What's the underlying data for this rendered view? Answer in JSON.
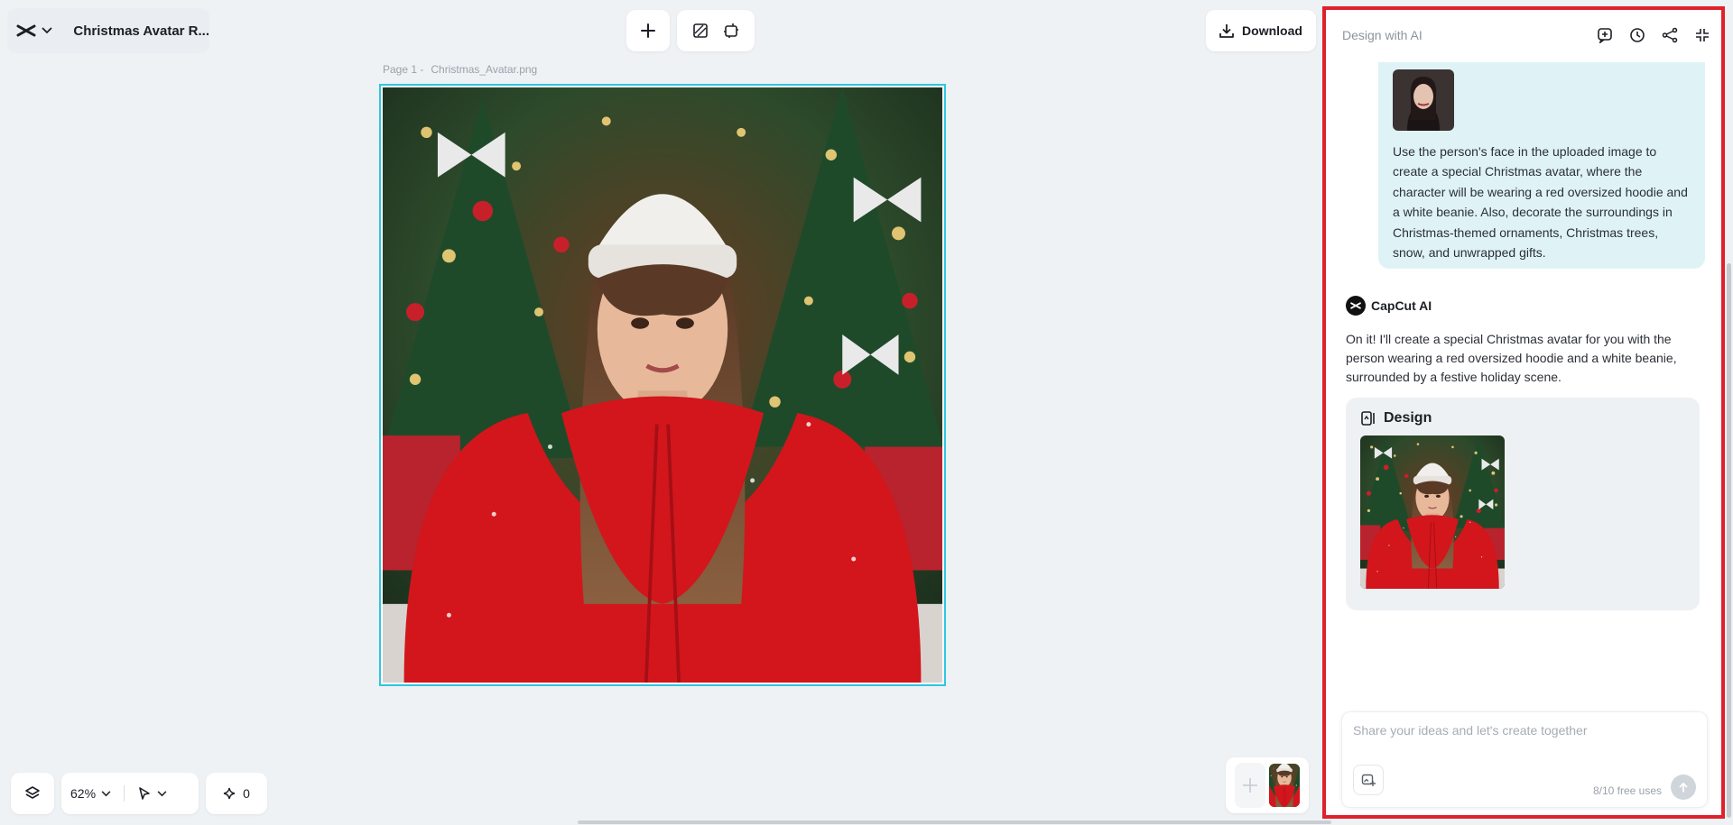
{
  "app": {
    "document_title": "Christmas Avatar R..."
  },
  "toolbar": {
    "download_label": "Download"
  },
  "canvas": {
    "page_label": "Page 1 -",
    "file_name": "Christmas_Avatar.png"
  },
  "bottom_bar": {
    "zoom": "62%",
    "credits": "0"
  },
  "panel": {
    "title": "Design with AI",
    "user_message": "Use the person's face in the uploaded image to create a special Christmas avatar, where the character will be wearing a red oversized hoodie and a white beanie. Also, decorate the surroundings in Christmas-themed ornaments, Christmas trees, snow, and unwrapped gifts.",
    "assistant_name": "CapCut AI",
    "assistant_message": "On it! I'll create a special Christmas avatar for you with the person wearing a red oversized hoodie and a white beanie, surrounded by a festive holiday scene.",
    "design_card_title": "Design",
    "input_placeholder": "Share your ideas and let's create together",
    "free_uses": "8/10 free uses"
  },
  "colors": {
    "selection": "#30c5e0",
    "panel_highlight": "#e0212c",
    "user_bubble": "#dff3f7"
  }
}
